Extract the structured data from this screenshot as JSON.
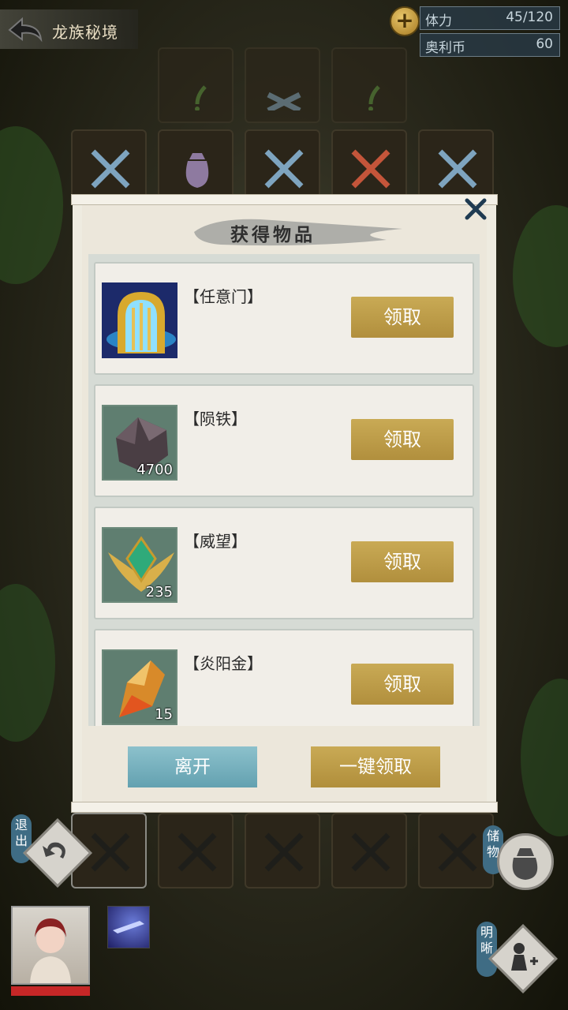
{
  "topbar": {
    "title": "龙族秘境",
    "plus_label": "+"
  },
  "resources": [
    {
      "label": "体力",
      "value": "45/120"
    },
    {
      "label": "奥利币",
      "value": "60"
    }
  ],
  "modal": {
    "title": "获得物品",
    "items": [
      {
        "name": "【任意门】",
        "count": "",
        "claim_label": "领取",
        "icon": "golden-portal-icon"
      },
      {
        "name": "【陨铁】",
        "count": "4700",
        "claim_label": "领取",
        "icon": "meteor-iron-icon"
      },
      {
        "name": "【威望】",
        "count": "235",
        "claim_label": "领取",
        "icon": "prestige-emblem-icon"
      },
      {
        "name": "【炎阳金】",
        "count": "15",
        "claim_label": "领取",
        "icon": "blaze-gold-icon"
      }
    ],
    "leave_label": "离开",
    "claim_all_label": "一键领取"
  },
  "side": {
    "exit_label": "退出",
    "storage_label": "储物",
    "clarity_label": "明晰"
  },
  "colors": {
    "claim_button": "#bb9a47",
    "leave_button": "#75aebb",
    "hp_bar": "#c62727"
  }
}
